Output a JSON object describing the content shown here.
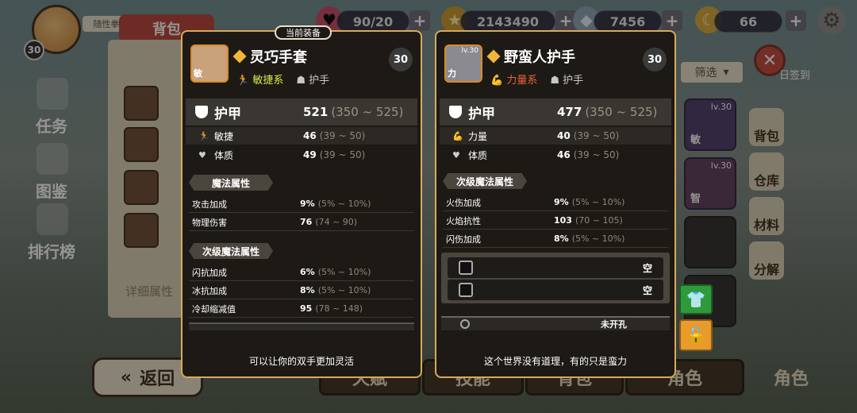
{
  "hud": {
    "level": "30",
    "random_tag": "随性拳",
    "resources": [
      {
        "icon": "heart-icon",
        "value": "90/20"
      },
      {
        "icon": "star-icon",
        "value": "2143490"
      },
      {
        "icon": "diamond-icon",
        "value": "7456"
      },
      {
        "icon": "moon-icon",
        "value": "66"
      }
    ]
  },
  "background": {
    "banner": "背包",
    "left_nav": [
      "任务",
      "图鉴",
      "排行榜"
    ],
    "detail_button": "详细属性",
    "back_button": "返回",
    "bottom_tabs": [
      "天赋",
      "技能",
      "背包",
      "角色",
      "角色"
    ],
    "filter": "筛选",
    "checkin": "日签到",
    "right_tabs": [
      "背包",
      "仓库",
      "材料",
      "分解"
    ],
    "inventory": [
      {
        "lv": "lv.30",
        "tag": "敏"
      },
      {
        "lv": "lv.30",
        "tag": "智"
      }
    ]
  },
  "equipped_item": {
    "badge": "当前装备",
    "icon_tag": "敏",
    "name": "灵巧手套",
    "type_label": "敏捷系",
    "slot_label": "护手",
    "level": "30",
    "armor": {
      "label": "护甲",
      "value": "521",
      "range": "(350 ~ 525)"
    },
    "stats": [
      {
        "label": "敏捷",
        "value": "46",
        "range": "(39 ~ 50)"
      },
      {
        "label": "体质",
        "value": "49",
        "range": "(39 ~ 50)"
      }
    ],
    "magic_header": "魔法属性",
    "magic": [
      {
        "label": "攻击加成",
        "value": "9%",
        "range": "(5% ~ 10%)"
      },
      {
        "label": "物理伤害",
        "value": "76",
        "range": "(74 ~ 90)"
      }
    ],
    "secondary_header": "次级魔法属性",
    "secondary": [
      {
        "label": "闪抗加成",
        "value": "6%",
        "range": "(5% ~ 10%)"
      },
      {
        "label": "冰抗加成",
        "value": "8%",
        "range": "(5% ~ 10%)"
      },
      {
        "label": "冷却缩减值",
        "value": "95",
        "range": "(78 ~ 148)"
      }
    ],
    "description": "可以让你的双手更加灵活"
  },
  "compare_item": {
    "icon_tag": "力",
    "icon_level": "lv.30",
    "name": "野蛮人护手",
    "type_label": "力量系",
    "slot_label": "护手",
    "level": "30",
    "armor": {
      "label": "护甲",
      "value": "477",
      "range": "(350 ~ 525)"
    },
    "stats": [
      {
        "label": "力量",
        "value": "40",
        "range": "(39 ~ 50)"
      },
      {
        "label": "体质",
        "value": "46",
        "range": "(39 ~ 50)"
      }
    ],
    "secondary_header": "次级魔法属性",
    "secondary": [
      {
        "label": "火伤加成",
        "value": "9%",
        "range": "(5% ~ 10%)"
      },
      {
        "label": "火焰抗性",
        "value": "103",
        "range": "(70 ~ 105)"
      },
      {
        "label": "闪伤加成",
        "value": "8%",
        "range": "(5% ~ 10%)"
      }
    ],
    "sockets": [
      "空",
      "空"
    ],
    "partial_row": "未开孔",
    "description": "这个世界没有道理，有的只是蛮力"
  },
  "colors": {
    "gold_border": "#d9a95a",
    "agility": "#d6e84a",
    "strength": "#e8603a",
    "panel_bg": "#1d1a16"
  }
}
